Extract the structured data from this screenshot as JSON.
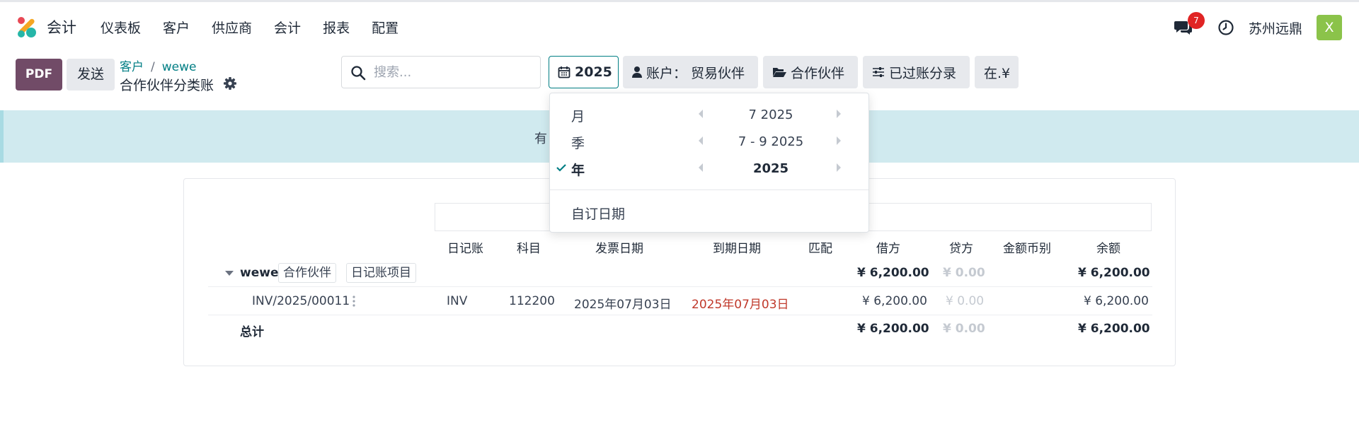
{
  "navbar": {
    "app_name": "会计",
    "menu": [
      "仪表板",
      "客户",
      "供应商",
      "会计",
      "报表",
      "配置"
    ],
    "notification_count": "7",
    "company": "苏州远鼎",
    "avatar_letter": "X"
  },
  "control_panel": {
    "pdf_label": "PDF",
    "send_label": "发送",
    "breadcrumb": [
      "客户",
      "wewe"
    ],
    "title": "合作伙伴分类账",
    "search_placeholder": "搜索...",
    "filters": {
      "date": "2025",
      "account": "账户： 贸易伙伴",
      "partner": "合作伙伴",
      "posted": "已过账分录",
      "currency": "在.¥"
    }
  },
  "alert": {
    "text": "有"
  },
  "date_dropdown": {
    "items": [
      {
        "label": "月",
        "value": "7 2025",
        "selected": false
      },
      {
        "label": "季",
        "value": "7 - 9 2025",
        "selected": false
      },
      {
        "label": "年",
        "value": "2025",
        "selected": true
      }
    ],
    "custom_label": "自订日期"
  },
  "report": {
    "columns": [
      "日记账",
      "科目",
      "发票日期",
      "到期日期",
      "匹配",
      "借方",
      "贷方",
      "金额币别",
      "余额"
    ],
    "group": {
      "name": "wewe",
      "tags": [
        "合作伙伴",
        "日记账项目"
      ],
      "debit": "¥ 6,200.00",
      "credit": "¥ 0.00",
      "balance": "¥ 6,200.00"
    },
    "lines": [
      {
        "move": "INV/2025/00011",
        "journal": "INV",
        "account": "112200",
        "invoice_date": "2025年07月03日",
        "due_date": "2025年07月03日",
        "debit": "¥ 6,200.00",
        "credit": "¥ 0.00",
        "balance": "¥ 6,200.00"
      }
    ],
    "total": {
      "label": "总计",
      "debit": "¥ 6,200.00",
      "credit": "¥ 0.00",
      "balance": "¥ 6,200.00"
    }
  },
  "colors": {
    "brand": "#714b67",
    "link": "#017e84",
    "alert_bg": "#d0eaef",
    "overdue": "#c0392b",
    "badge": "#e02424",
    "avatar": "#8bc34a"
  }
}
